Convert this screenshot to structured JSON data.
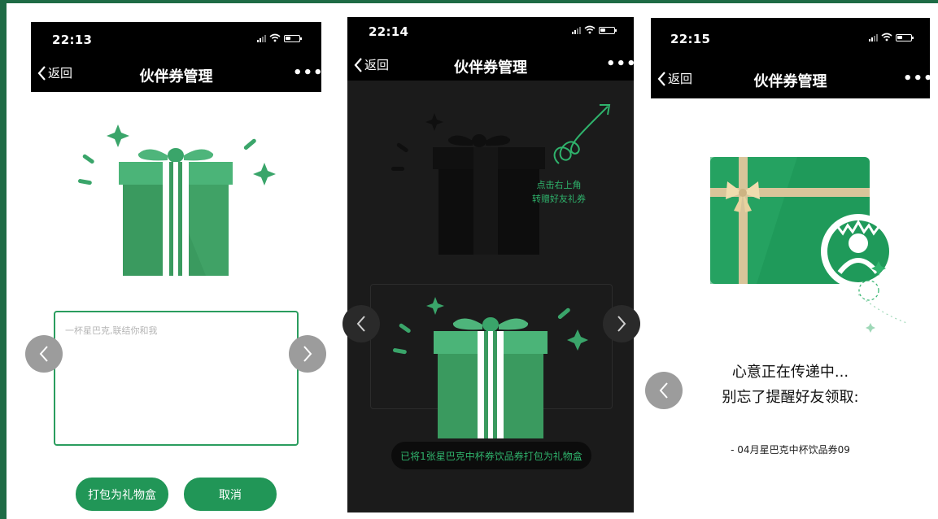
{
  "screens": [
    {
      "time": "22:13",
      "back_label": "返回",
      "title": "伙伴券管理",
      "more_label": "•••",
      "message_placeholder": "一杯星巴克,联结你和我",
      "wrap_button_label": "打包为礼物盒",
      "cancel_button_label": "取消"
    },
    {
      "time": "22:14",
      "back_label": "返回",
      "title": "伙伴券管理",
      "more_label": "•••",
      "hint_line1": "点击右上角",
      "hint_line2": "转赠好友礼券",
      "status_message": "已将1张星巴克中杯券饮品券打包为礼物盒"
    },
    {
      "time": "22:15",
      "back_label": "返回",
      "title": "伙伴券管理",
      "more_label": "•••",
      "message_line1": "心意正在传递中...",
      "message_line2": "别忘了提醒好友领取:",
      "coupon_line": "- 04月星巴克中杯饮品券09"
    }
  ],
  "colors": {
    "brand_green": "#219657",
    "frame_green": "#1e6b45",
    "dark_overlay": "#1b1b1b"
  },
  "icons": [
    "back-chevron-icon",
    "signal-icon",
    "wifi-icon",
    "battery-icon",
    "gift-box-icon",
    "sparkle-icon",
    "arrow-swirl-icon",
    "gift-card-icon",
    "starbucks-logo-icon"
  ]
}
